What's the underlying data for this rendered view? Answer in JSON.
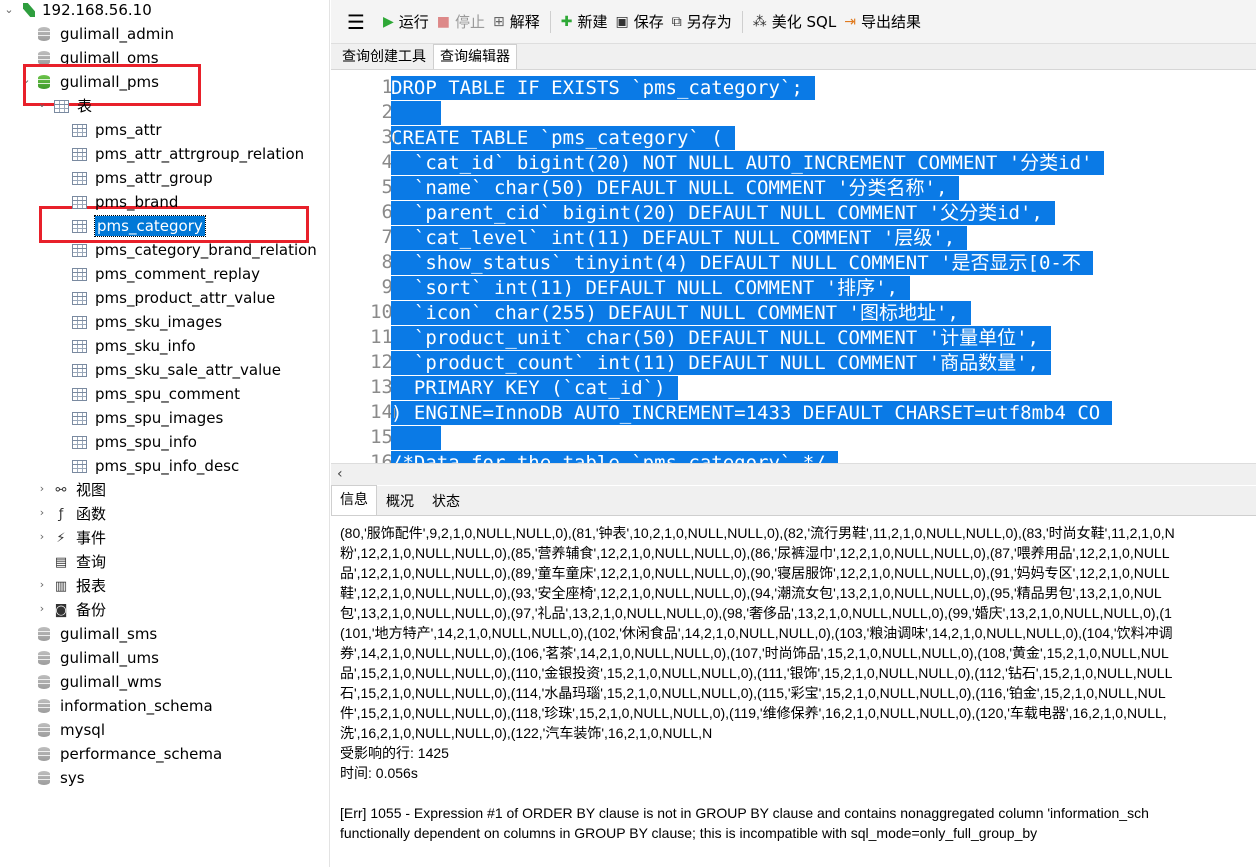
{
  "navigator": {
    "connection": "192.168.56.10",
    "databases_top": [
      "gulimall_admin",
      "gulimall_oms"
    ],
    "active_db": "gulimall_pms",
    "tables_group": "表",
    "tables": [
      "pms_attr",
      "pms_attr_attrgroup_relation",
      "pms_attr_group",
      "pms_brand",
      "pms_category",
      "pms_category_brand_relation",
      "pms_comment_replay",
      "pms_product_attr_value",
      "pms_sku_images",
      "pms_sku_info",
      "pms_sku_sale_attr_value",
      "pms_spu_comment",
      "pms_spu_images",
      "pms_spu_info",
      "pms_spu_info_desc"
    ],
    "selected_table": "pms_category",
    "groups": [
      "视图",
      "函数",
      "事件",
      "查询",
      "报表",
      "备份"
    ],
    "databases_bottom": [
      "gulimall_sms",
      "gulimall_ums",
      "gulimall_wms",
      "information_schema",
      "mysql",
      "performance_schema",
      "sys"
    ]
  },
  "toolbar": {
    "run": "运行",
    "stop": "停止",
    "explain": "解释",
    "new": "新建",
    "save": "保存",
    "save_as": "另存为",
    "beautify": "美化 SQL",
    "export": "导出结果"
  },
  "editor_tabs": [
    "查询创建工具",
    "查询编辑器"
  ],
  "code_lines": [
    "DROP TABLE IF EXISTS `pms_category`;",
    "",
    "CREATE TABLE `pms_category` (",
    "  `cat_id` bigint(20) NOT NULL AUTO_INCREMENT COMMENT '分类id'",
    "  `name` char(50) DEFAULT NULL COMMENT '分类名称',",
    "  `parent_cid` bigint(20) DEFAULT NULL COMMENT '父分类id',",
    "  `cat_level` int(11) DEFAULT NULL COMMENT '层级',",
    "  `show_status` tinyint(4) DEFAULT NULL COMMENT '是否显示[0-不",
    "  `sort` int(11) DEFAULT NULL COMMENT '排序',",
    "  `icon` char(255) DEFAULT NULL COMMENT '图标地址',",
    "  `product_unit` char(50) DEFAULT NULL COMMENT '计量单位',",
    "  `product_count` int(11) DEFAULT NULL COMMENT '商品数量',",
    "  PRIMARY KEY (`cat_id`)",
    ") ENGINE=InnoDB AUTO_INCREMENT=1433 DEFAULT CHARSET=utf8mb4 CO",
    "",
    "/*Data for the table `pms_category` */"
  ],
  "line_numbers": [
    "1",
    "2",
    "3",
    "4",
    "5",
    "6",
    "7",
    "8",
    "9",
    "10",
    "11",
    "12",
    "13",
    "14",
    "15",
    "16"
  ],
  "result_tabs": [
    "信息",
    "概况",
    "状态"
  ],
  "messages": [
    "(80,'服饰配件',9,2,1,0,NULL,NULL,0),(81,'钟表',10,2,1,0,NULL,NULL,0),(82,'流行男鞋',11,2,1,0,NULL,NULL,0),(83,'时尚女鞋',11,2,1,0,N",
    "粉',12,2,1,0,NULL,NULL,0),(85,'营养辅食',12,2,1,0,NULL,NULL,0),(86,'尿裤湿巾',12,2,1,0,NULL,NULL,0),(87,'喂养用品',12,2,1,0,NULL",
    "品',12,2,1,0,NULL,NULL,0),(89,'童车童床',12,2,1,0,NULL,NULL,0),(90,'寝居服饰',12,2,1,0,NULL,NULL,0),(91,'妈妈专区',12,2,1,0,NULL",
    "鞋',12,2,1,0,NULL,NULL,0),(93,'安全座椅',12,2,1,0,NULL,NULL,0),(94,'潮流女包',13,2,1,0,NULL,NULL,0),(95,'精品男包',13,2,1,0,NUL",
    "包',13,2,1,0,NULL,NULL,0),(97,'礼品',13,2,1,0,NULL,NULL,0),(98,'奢侈品',13,2,1,0,NULL,NULL,0),(99,'婚庆',13,2,1,0,NULL,NULL,0),(1",
    "(101,'地方特产',14,2,1,0,NULL,NULL,0),(102,'休闲食品',14,2,1,0,NULL,NULL,0),(103,'粮油调味',14,2,1,0,NULL,NULL,0),(104,'饮料冲调",
    "券',14,2,1,0,NULL,NULL,0),(106,'茗茶',14,2,1,0,NULL,NULL,0),(107,'时尚饰品',15,2,1,0,NULL,NULL,0),(108,'黄金',15,2,1,0,NULL,NUL",
    "品',15,2,1,0,NULL,NULL,0),(110,'金银投资',15,2,1,0,NULL,NULL,0),(111,'银饰',15,2,1,0,NULL,NULL,0),(112,'钻石',15,2,1,0,NULL,NULL",
    "石',15,2,1,0,NULL,NULL,0),(114,'水晶玛瑙',15,2,1,0,NULL,NULL,0),(115,'彩宝',15,2,1,0,NULL,NULL,0),(116,'铂金',15,2,1,0,NULL,NUL",
    "件',15,2,1,0,NULL,NULL,0),(118,'珍珠',15,2,1,0,NULL,NULL,0),(119,'维修保养',16,2,1,0,NULL,NULL,0),(120,'车载电器',16,2,1,0,NULL,",
    "洗',16,2,1,0,NULL,NULL,0),(122,'汽车装饰',16,2,1,0,NULL,N",
    "受影响的行: 1425",
    "时间: 0.056s",
    "",
    "[Err] 1055 - Expression #1 of ORDER BY clause is not in GROUP BY clause and contains nonaggregated column 'information_sch",
    "functionally dependent on columns in GROUP BY clause; this is incompatible with sql_mode=only_full_group_by"
  ],
  "colors": {
    "selection": "#0a7ae6",
    "highlight_box": "#e8202a",
    "db_active": "#3d9a2a",
    "run_icon": "#2ea836",
    "stop_icon": "#c44"
  }
}
